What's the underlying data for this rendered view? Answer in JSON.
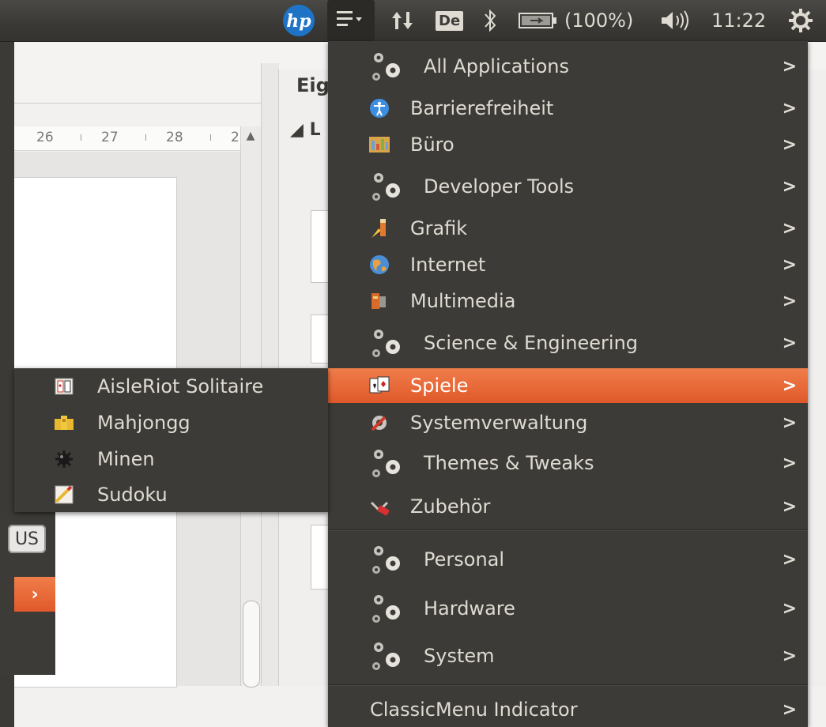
{
  "top_panel": {
    "keyboard_layout": "De",
    "battery_text": "(100%)",
    "clock": "11:22",
    "icons": [
      "hp-logo-icon",
      "classicmenu-icon",
      "network-icon",
      "keyboard-layout-icon",
      "bluetooth-icon",
      "battery-icon",
      "volume-icon",
      "session-icon"
    ]
  },
  "background": {
    "sidebar_heading": "Eig",
    "sidebar_section": "L",
    "ruler": [
      "26",
      "27",
      "28",
      "2"
    ],
    "remnant_button": "US"
  },
  "main_menu": {
    "items": [
      {
        "label": "All Applications",
        "icon": "gears-icon"
      },
      {
        "label": "Barrierefreiheit",
        "icon": "accessibility-icon"
      },
      {
        "label": "Büro",
        "icon": "office-icon"
      },
      {
        "label": "Developer Tools",
        "icon": "gears-icon"
      },
      {
        "label": "Grafik",
        "icon": "graphics-icon"
      },
      {
        "label": "Internet",
        "icon": "internet-globe-icon"
      },
      {
        "label": "Multimedia",
        "icon": "multimedia-icon"
      },
      {
        "label": "Science & Engineering",
        "icon": "gears-icon"
      },
      {
        "label": "Spiele",
        "icon": "games-cards-icon"
      },
      {
        "label": "Systemverwaltung",
        "icon": "system-tools-icon"
      },
      {
        "label": "Themes & Tweaks",
        "icon": "gears-icon"
      },
      {
        "label": "Zubehör",
        "icon": "accessories-icon"
      },
      {
        "label": "Personal",
        "icon": "gears-icon"
      },
      {
        "label": "Hardware",
        "icon": "gears-icon"
      },
      {
        "label": "System",
        "icon": "gears-icon"
      },
      {
        "label": "ClassicMenu Indicator",
        "icon": ""
      }
    ],
    "chevron": ">"
  },
  "games_submenu": {
    "items": [
      {
        "label": "AisleRiot Solitaire",
        "icon": "solitaire-cards-icon"
      },
      {
        "label": "Mahjongg",
        "icon": "mahjongg-tiles-icon"
      },
      {
        "label": "Minen",
        "icon": "mine-icon"
      },
      {
        "label": "Sudoku",
        "icon": "sudoku-icon"
      }
    ]
  },
  "colors": {
    "panel_bg": "#3c3b37",
    "menu_bg": "#3c3b37",
    "highlight": "#e96a37",
    "text": "#dfdbd2"
  }
}
